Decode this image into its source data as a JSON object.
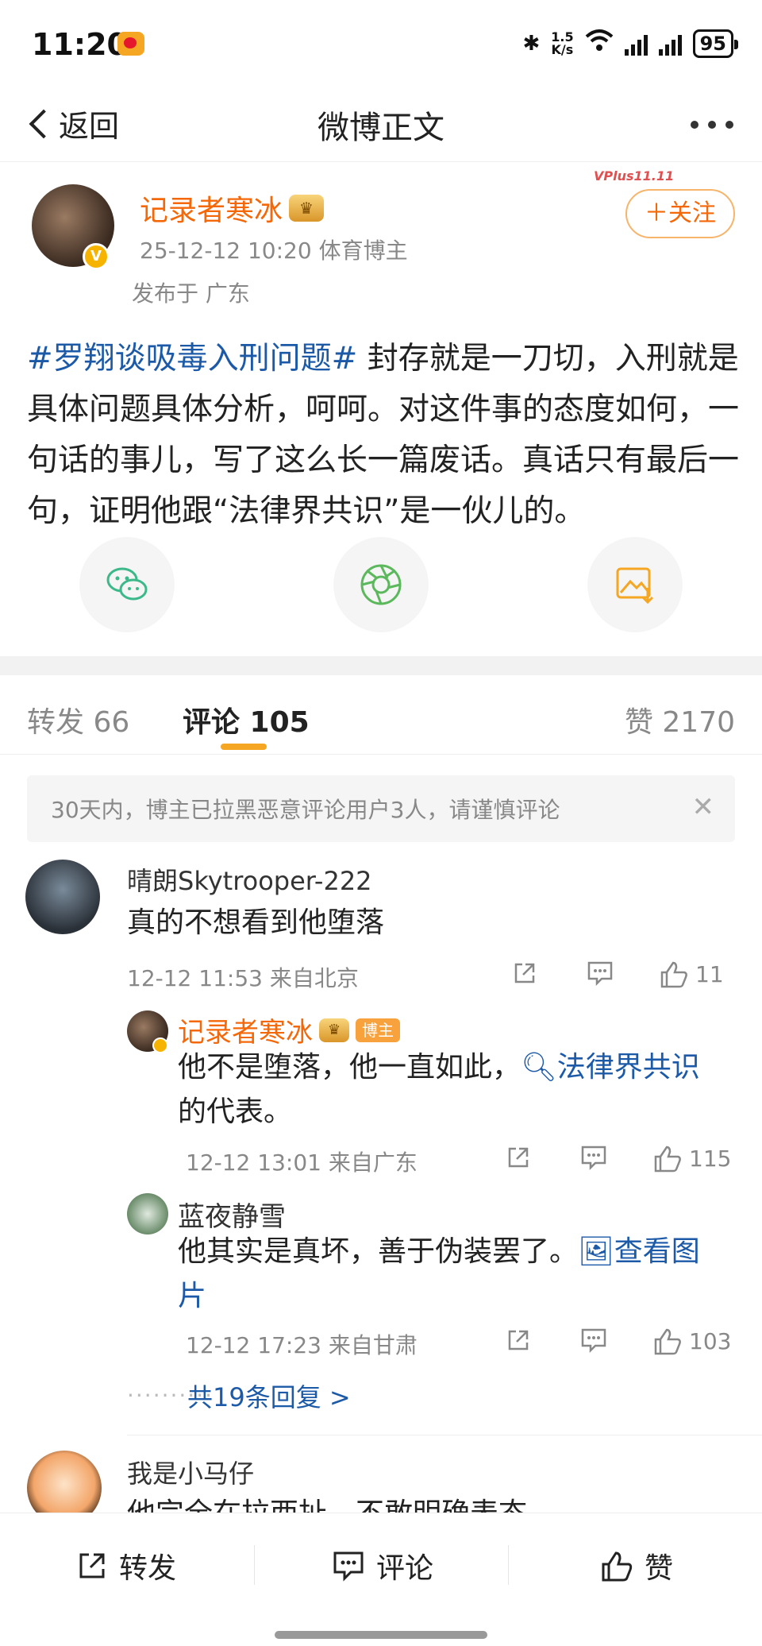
{
  "status_bar": {
    "time": "11:20",
    "net_speed_top": "1.5",
    "net_speed_unit": "K/s",
    "battery": "95"
  },
  "nav": {
    "back_label": "返回",
    "title": "微博正文"
  },
  "post": {
    "author": "记录者寒冰",
    "crown_badge": "",
    "date": "25-12-12 10:20",
    "role": "体育博主",
    "location": "发布于 广东",
    "vplus_tag": "VPlus11.11",
    "follow_label": "＋关注",
    "topic": "#罗翔谈吸毒入刑问题#",
    "text": " 封存就是一刀切，入刑就是具体问题具体分析，呵呵。对这件事的态度如何，一句话的事儿，写了这么长一篇废话。真话只有最后一句，证明他跟“法律界共识”是一伙儿的。"
  },
  "share_icons": [
    "wechat-icon",
    "moments-icon",
    "save-image-icon"
  ],
  "tabs": {
    "repost": "转发 66",
    "comment": "评论 105",
    "like": "赞 2170"
  },
  "notice": "30天内，博主已拉黑恶意评论用户3人，请谨慎评论",
  "comments": [
    {
      "user": "晴朗Skytrooper-222",
      "text": "真的不想看到他堕落",
      "meta": "12-12 11:53 来自北京",
      "likes": "11"
    },
    {
      "user": "我是小马仔",
      "text": "他完全在拉西扯，不敢明确表态"
    }
  ],
  "replies": [
    {
      "user": "记录者寒冰",
      "badge": "博主",
      "text_before": "他不是堕落，他一直如此，",
      "link": "法律界共识",
      "text_after": "的代表。",
      "meta": "12-12 13:01 来自广东",
      "likes": "115"
    },
    {
      "user": "蓝夜静雪",
      "text_before": "他其实是真坏，善于伪装罢了。",
      "link": "查看图片",
      "meta": "12-12 17:23 来自甘肃",
      "likes": "103"
    }
  ],
  "more_replies": "共19条回复 >",
  "bottom_bar": {
    "repost": "转发",
    "comment": "评论",
    "like": "赞"
  },
  "colors": {
    "accent_orange": "#f5680a",
    "link_blue": "#1c5aa8",
    "tab_indicator": "#f5a623"
  }
}
